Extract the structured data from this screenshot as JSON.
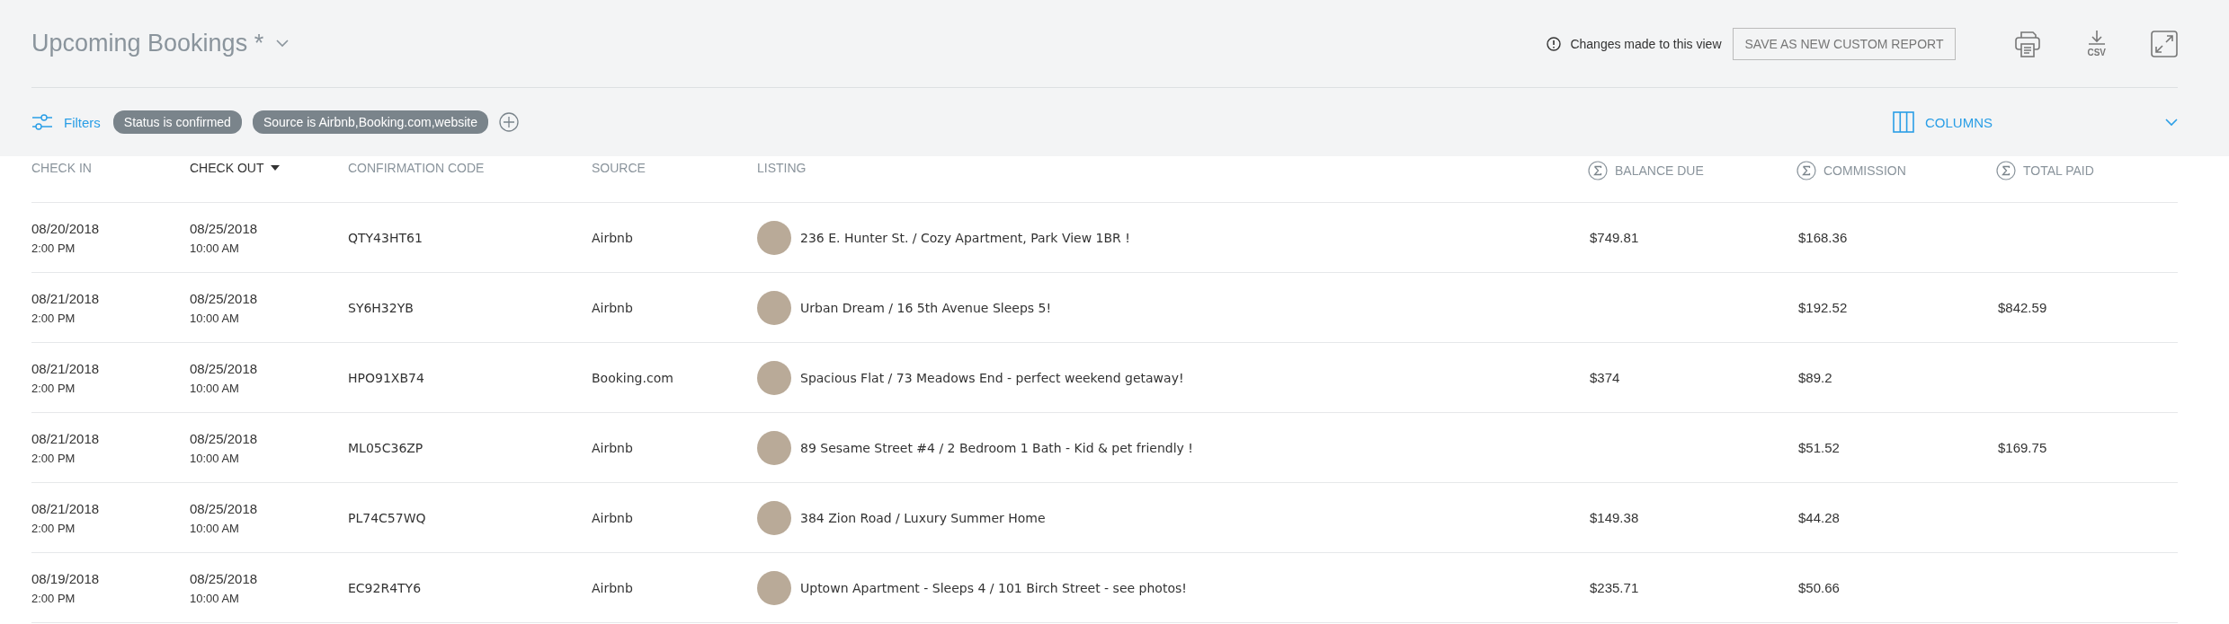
{
  "report": {
    "title": "Upcoming Bookings *",
    "notice": "Changes made to this view",
    "save_button": "SAVE AS NEW CUSTOM REPORT",
    "csv_label": "CSV"
  },
  "filters": {
    "label": "Filters",
    "chips": [
      "Status is confirmed",
      "Source is Airbnb,Booking.com,website"
    ],
    "columns_label": "COLUMNS"
  },
  "table": {
    "columns": [
      {
        "label": "CHECK IN",
        "sorted": false,
        "kind": "plain"
      },
      {
        "label": "CHECK OUT",
        "sorted": true,
        "kind": "plain"
      },
      {
        "label": "CONFIRMATION CODE",
        "sorted": false,
        "kind": "plain"
      },
      {
        "label": "SOURCE",
        "sorted": false,
        "kind": "plain"
      },
      {
        "label": "LISTING",
        "sorted": false,
        "kind": "plain"
      },
      {
        "label": "BALANCE DUE",
        "sorted": false,
        "kind": "sum"
      },
      {
        "label": "COMMISSION",
        "sorted": false,
        "kind": "sum"
      },
      {
        "label": "TOTAL PAID",
        "sorted": false,
        "kind": "sum"
      }
    ],
    "rows": [
      {
        "check_in_date": "08/20/2018",
        "check_in_time": "2:00 PM",
        "check_out_date": "08/25/2018",
        "check_out_time": "10:00 AM",
        "code": "QTY43HT61",
        "source": "Airbnb",
        "listing": "236  E. Hunter St. / Cozy Apartment, Park View 1BR !",
        "balance_due": "$749.81",
        "commission": "$168.36",
        "total_paid": ""
      },
      {
        "check_in_date": "08/21/2018",
        "check_in_time": "2:00 PM",
        "check_out_date": "08/25/2018",
        "check_out_time": "10:00 AM",
        "code": "SY6H32YB",
        "source": "Airbnb",
        "listing": "Urban Dream / 16 5th Avenue Sleeps 5!",
        "balance_due": "",
        "commission": "$192.52",
        "total_paid": "$842.59"
      },
      {
        "check_in_date": "08/21/2018",
        "check_in_time": "2:00 PM",
        "check_out_date": "08/25/2018",
        "check_out_time": "10:00 AM",
        "code": "HPO91XB74",
        "source": "Booking.com",
        "listing": "Spacious Flat / 73 Meadows End - perfect weekend getaway!",
        "balance_due": "$374",
        "commission": "$89.2",
        "total_paid": ""
      },
      {
        "check_in_date": "08/21/2018",
        "check_in_time": "2:00 PM",
        "check_out_date": "08/25/2018",
        "check_out_time": "10:00 AM",
        "code": "ML05C36ZP",
        "source": "Airbnb",
        "listing": "89  Sesame Street #4 / 2 Bedroom 1 Bath - Kid & pet friendly !",
        "balance_due": "",
        "commission": "$51.52",
        "total_paid": "$169.75"
      },
      {
        "check_in_date": "08/21/2018",
        "check_in_time": "2:00 PM",
        "check_out_date": "08/25/2018",
        "check_out_time": "10:00 AM",
        "code": "PL74C57WQ",
        "source": "Airbnb",
        "listing": "384  Zion Road / Luxury Summer Home",
        "balance_due": "$149.38",
        "commission": "$44.28",
        "total_paid": ""
      },
      {
        "check_in_date": "08/19/2018",
        "check_in_time": "2:00 PM",
        "check_out_date": "08/25/2018",
        "check_out_time": "10:00 AM",
        "code": "EC92R4TY6",
        "source": "Airbnb",
        "listing": "Uptown Apartment - Sleeps 4 / 101 Birch Street - see photos!",
        "balance_due": "$235.71",
        "commission": "$50.66",
        "total_paid": ""
      }
    ]
  }
}
